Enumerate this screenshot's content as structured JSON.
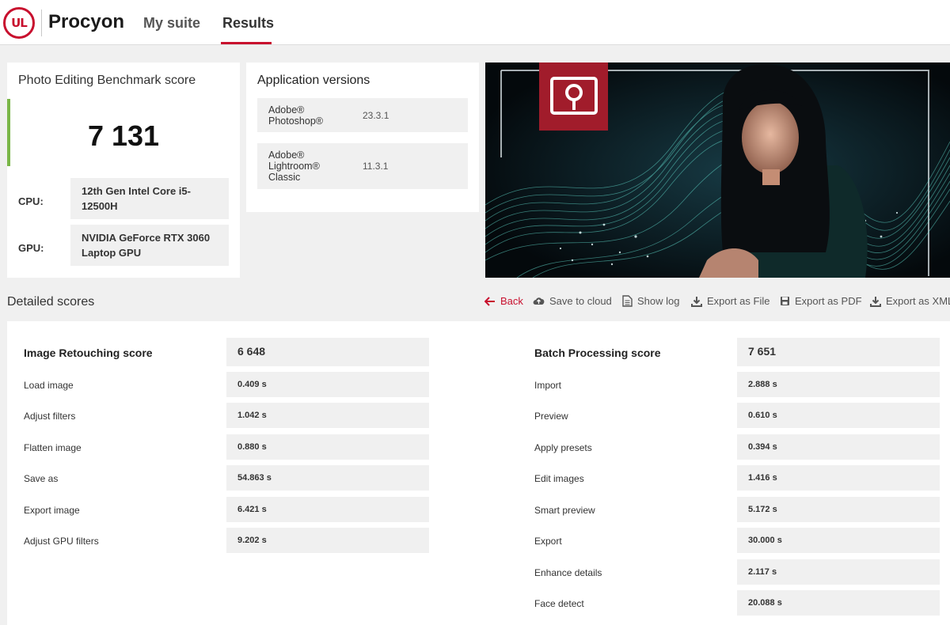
{
  "header": {
    "logo_text": "UL",
    "app_title": "Procyon",
    "tabs": [
      {
        "label": "My suite"
      },
      {
        "label": "Results"
      }
    ]
  },
  "score_card": {
    "title": "Photo Editing Benchmark score",
    "score": "7 131",
    "accent_color": "#7ab648",
    "cpu_label": "CPU:",
    "cpu_value": "12th Gen Intel Core i5-12500H",
    "gpu_label": "GPU:",
    "gpu_value": "NVIDIA GeForce RTX 3060 Laptop GPU"
  },
  "versions": {
    "title": "Application versions",
    "apps": [
      {
        "name_line1": "Adobe®",
        "name_line2": "Photoshop®",
        "name_line3": "",
        "version": "23.3.1"
      },
      {
        "name_line1": "Adobe®",
        "name_line2": "Lightroom®",
        "name_line3": "Classic",
        "version": "11.3.1"
      }
    ]
  },
  "detailed": {
    "title": "Detailed scores",
    "actions": {
      "back": "Back",
      "save_cloud": "Save to cloud",
      "show_log": "Show log",
      "export_file": "Export as File",
      "export_pdf": "Export as PDF",
      "export_xml": "Export as XML"
    },
    "retouching": {
      "title": "Image Retouching score",
      "score": "6 648",
      "rows": [
        {
          "label": "Load image",
          "value": "0.409 s"
        },
        {
          "label": "Adjust filters",
          "value": "1.042 s"
        },
        {
          "label": "Flatten image",
          "value": "0.880 s"
        },
        {
          "label": "Save as",
          "value": "54.863 s"
        },
        {
          "label": "Export image",
          "value": "6.421 s"
        },
        {
          "label": "Adjust GPU filters",
          "value": "9.202 s"
        }
      ]
    },
    "batch": {
      "title": "Batch Processing score",
      "score": "7 651",
      "rows": [
        {
          "label": "Import",
          "value": "2.888 s"
        },
        {
          "label": "Preview",
          "value": "0.610 s"
        },
        {
          "label": "Apply presets",
          "value": "0.394 s"
        },
        {
          "label": "Edit images",
          "value": "1.416 s"
        },
        {
          "label": "Smart preview",
          "value": "5.172 s"
        },
        {
          "label": "Export",
          "value": "30.000 s"
        },
        {
          "label": "Enhance details",
          "value": "2.117 s"
        },
        {
          "label": "Face detect",
          "value": "20.088 s"
        }
      ]
    }
  },
  "colors": {
    "brand_red": "#c8102e",
    "banner_dark": "#06131a",
    "wave_teal": "#5fd6c8"
  },
  "icons": {
    "back": "arrow-left-icon",
    "cloud": "cloud-upload-icon",
    "log": "document-icon",
    "download": "download-icon",
    "pdf": "save-disk-icon"
  }
}
